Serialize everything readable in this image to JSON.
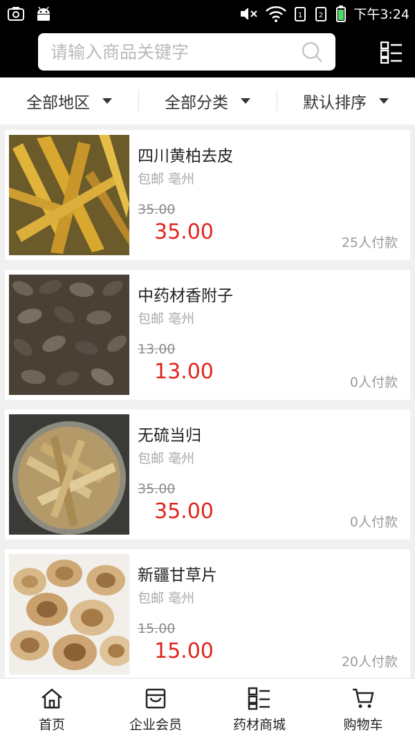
{
  "status_bar": {
    "time": "下午3:24"
  },
  "search": {
    "placeholder": "请输入商品关键字"
  },
  "filters": [
    {
      "label": "全部地区"
    },
    {
      "label": "全部分类"
    },
    {
      "label": "默认排序"
    }
  ],
  "products": [
    {
      "title": "四川黄柏去皮",
      "shipping": "包邮",
      "location": "亳州",
      "original_price": "35.00",
      "price": "35.00",
      "sold": "25人付款"
    },
    {
      "title": "中药材香附子",
      "shipping": "包邮",
      "location": "亳州",
      "original_price": "13.00",
      "price": "13.00",
      "sold": "0人付款"
    },
    {
      "title": "无硫当归",
      "shipping": "包邮",
      "location": "亳州",
      "original_price": "35.00",
      "price": "35.00",
      "sold": "0人付款"
    },
    {
      "title": "新疆甘草片",
      "shipping": "包邮",
      "location": "亳州",
      "original_price": "15.00",
      "price": "15.00",
      "sold": "20人付款"
    }
  ],
  "bottom_nav": [
    {
      "label": "首页",
      "icon": "home-icon"
    },
    {
      "label": "企业会员",
      "icon": "store-icon"
    },
    {
      "label": "药材商城",
      "icon": "grid-list-icon"
    },
    {
      "label": "购物车",
      "icon": "cart-icon"
    }
  ]
}
